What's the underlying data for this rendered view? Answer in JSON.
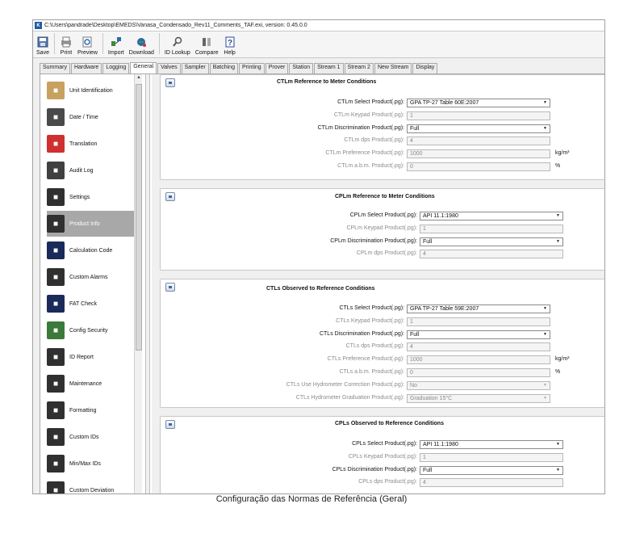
{
  "window": {
    "title": "C:\\Users\\pandrade\\Desktop\\EMEDS\\Vanasa_Condensado_Rev11_Comments_TAF.exi, version: 0.45.0.0",
    "app_icon": "K"
  },
  "toolbar": [
    {
      "label": "Save",
      "icon": "save-icon"
    },
    {
      "label": "Print",
      "icon": "print-icon"
    },
    {
      "label": "Preview",
      "icon": "preview-icon"
    },
    {
      "label": "Import",
      "icon": "import-icon"
    },
    {
      "label": "Download",
      "icon": "download-icon"
    },
    {
      "label": "ID Lookup",
      "icon": "id-lookup-icon"
    },
    {
      "label": "Compare",
      "icon": "compare-icon"
    },
    {
      "label": "Help",
      "icon": "help-icon"
    }
  ],
  "tabs": [
    {
      "label": "Summary"
    },
    {
      "label": "Hardware"
    },
    {
      "label": "Logging"
    },
    {
      "label": "General",
      "active": true
    },
    {
      "label": "Valves"
    },
    {
      "label": "Sampler"
    },
    {
      "label": "Batching"
    },
    {
      "label": "Printing"
    },
    {
      "label": "Prover"
    },
    {
      "label": "Station"
    },
    {
      "label": "Stream 1"
    },
    {
      "label": "Stream 2"
    },
    {
      "label": "New Stream"
    },
    {
      "label": "Display"
    }
  ],
  "sidebar": [
    {
      "label": "Unit Identification",
      "icon": "scroll-icon",
      "color": "#c8a060"
    },
    {
      "label": "Date / Time",
      "icon": "clock-icon",
      "color": "#4a4a4a"
    },
    {
      "label": "Translation",
      "icon": "translation-icon",
      "color": "#d03030"
    },
    {
      "label": "Audit Log",
      "icon": "audit-log-icon",
      "color": "#404040"
    },
    {
      "label": "Settings",
      "icon": "settings-icon",
      "color": "#303030"
    },
    {
      "label": "Product Info",
      "icon": "product-info-icon",
      "color": "#303030",
      "active": true
    },
    {
      "label": "Calculation Code",
      "icon": "calculation-icon",
      "color": "#1a2a5a"
    },
    {
      "label": "Custom Alarms",
      "icon": "alarm-icon",
      "color": "#303030"
    },
    {
      "label": "FAT Check",
      "icon": "fat-check-icon",
      "color": "#1a2a5a"
    },
    {
      "label": "Config Security",
      "icon": "security-icon",
      "color": "#3a7a3a"
    },
    {
      "label": "ID Report",
      "icon": "report-icon",
      "color": "#303030"
    },
    {
      "label": "Maintenance",
      "icon": "wrench-icon",
      "color": "#303030"
    },
    {
      "label": "Formatting",
      "icon": "formatting-icon",
      "color": "#303030"
    },
    {
      "label": "Custom IDs",
      "icon": "custom-ids-icon",
      "color": "#303030"
    },
    {
      "label": "Min/Max IDs",
      "icon": "min-max-icon",
      "color": "#303030"
    },
    {
      "label": "Custom Deviation",
      "icon": "deviation-icon",
      "color": "#303030"
    }
  ],
  "sections": [
    {
      "title": "CTLm Reference to Meter Conditions",
      "rows": [
        {
          "label": "CTLm Select Product(.pg):",
          "kind": "select-on",
          "value": "GPA TP-27 Table 60E:2007"
        },
        {
          "label": "CTLm Keypad Product(.pg):",
          "kind": "input-off",
          "value": "1"
        },
        {
          "label": "CTLm Discrimination Product(.pg):",
          "kind": "select-on",
          "value": "Full"
        },
        {
          "label": "CTLm dps Product(.pg):",
          "kind": "input-off",
          "value": "4"
        },
        {
          "label": "CTLm Preference Product(.pg):",
          "kind": "input-off",
          "value": "1000",
          "unit": "kg/m³"
        },
        {
          "label": "CTLm a.b.m. Product(.pg):",
          "kind": "input-off",
          "value": "0",
          "unit": "%"
        }
      ]
    },
    {
      "title": "CPLm Reference to Meter Conditions",
      "rows": [
        {
          "label": "CPLm Select Product(.pg):",
          "kind": "select-on",
          "value": "API 11.1:1980"
        },
        {
          "label": "CPLm Keypad Product(.pg):",
          "kind": "input-off",
          "value": "1"
        },
        {
          "label": "CPLm Discrimination Product(.pg):",
          "kind": "select-on",
          "value": "Full"
        },
        {
          "label": "CPLm dps Product(.pg):",
          "kind": "input-off",
          "value": "4"
        }
      ]
    },
    {
      "title": "CTLs Observed to Reference Conditions",
      "rows": [
        {
          "label": "CTLs Select Product(.pg):",
          "kind": "select-on",
          "value": "GPA TP-27 Table 59E:2007"
        },
        {
          "label": "CTLs Keypad Product(.pg):",
          "kind": "input-off",
          "value": "1"
        },
        {
          "label": "CTLs Discrimination Product(.pg):",
          "kind": "select-on",
          "value": "Full"
        },
        {
          "label": "CTLs dps Product(.pg):",
          "kind": "input-off",
          "value": "4"
        },
        {
          "label": "CTLs Preference Product(.pg):",
          "kind": "input-off",
          "value": "1000",
          "unit": "kg/m³"
        },
        {
          "label": "CTLs a.b.m. Product(.pg):",
          "kind": "input-off",
          "value": "0",
          "unit": "%"
        },
        {
          "label": "CTLs Use Hydrometer Correction Product(.pg):",
          "kind": "select-off",
          "value": "No"
        },
        {
          "label": "CTLs Hydrometer Graduation Product(.pg):",
          "kind": "select-off",
          "value": "Graduation 15°C"
        }
      ]
    },
    {
      "title": "CPLs Observed to Reference Conditions",
      "rows": [
        {
          "label": "CPLs Select Product(.pg):",
          "kind": "select-on",
          "value": "API 11.1:1980"
        },
        {
          "label": "CPLs Keypad Product(.pg):",
          "kind": "input-off",
          "value": "1"
        },
        {
          "label": "CPLs Discrimination Product(.pg):",
          "kind": "select-on",
          "value": "Full"
        },
        {
          "label": "CPLs dps Product(.pg):",
          "kind": "input-off",
          "value": "4"
        }
      ]
    }
  ],
  "caption": "Configuração das Normas de Referência (Geral)"
}
